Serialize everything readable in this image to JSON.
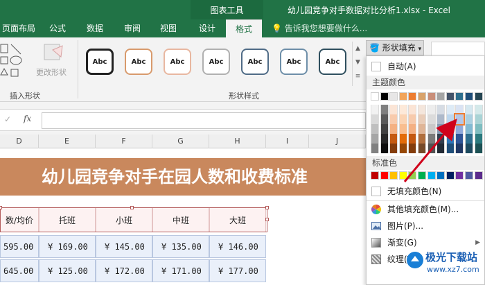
{
  "titlebar": {
    "context_group": "图表工具",
    "doc_title": "幼儿园竞争对手数据对比分析1.xlsx - Excel"
  },
  "tabs": [
    {
      "label": "页面布局"
    },
    {
      "label": "公式"
    },
    {
      "label": "数据"
    },
    {
      "label": "审阅"
    },
    {
      "label": "视图"
    },
    {
      "label": "设计"
    },
    {
      "label": "格式",
      "active": true
    }
  ],
  "tell_me": "告诉我您想要做什么...",
  "ribbon": {
    "insert_shapes_label": "插入形状",
    "edit_shape_label": "更改形状",
    "shape_styles_label": "形状样式",
    "style_preview_text": "Abc"
  },
  "formula_bar": {
    "fx": "fx",
    "cancel": "✓"
  },
  "columns": [
    "D",
    "E",
    "F",
    "G",
    "H",
    "I",
    "J"
  ],
  "sheet": {
    "banner": "幼儿园竞争对手在园人数和收费标准",
    "headers": [
      "数/均价",
      "托班",
      "小班",
      "中班",
      "大班"
    ],
    "rows": [
      [
        "595.00",
        "¥ 169.00",
        "¥ 145.00",
        "¥ 135.00",
        "¥ 146.00"
      ],
      [
        "645.00",
        "¥ 125.00",
        "¥ 172.00",
        "¥ 171.00",
        "¥ 177.00"
      ]
    ]
  },
  "shape_fill": {
    "button_label": "形状填充",
    "auto": "自动(A)",
    "theme_colors_label": "主题颜色",
    "standard_colors_label": "标准色",
    "no_fill": "无填充颜色(N)",
    "more_colors": "其他填充颜色(M)...",
    "picture": "图片(P)...",
    "gradient": "渐变(G)",
    "texture": "纹理(T)"
  },
  "theme_top_row": [
    "#ffffff",
    "#000000",
    "#e7e6e6",
    "#f2a45a",
    "#ed7d31",
    "#d9a36b",
    "#c98f7a",
    "#a5a5a5",
    "#44546a",
    "#2e6f8e",
    "#1f4e79",
    "#264653"
  ],
  "theme_shades": [
    [
      "#f2f2f2",
      "#d9d9d9",
      "#bfbfbf",
      "#a6a6a6",
      "#808080"
    ],
    [
      "#7f7f7f",
      "#595959",
      "#404040",
      "#262626",
      "#0d0d0d"
    ],
    [
      "#fbe5d6",
      "#f8cbad",
      "#f4b183",
      "#c55a11",
      "#843c0c"
    ],
    [
      "#fde9d9",
      "#fbd4b4",
      "#f9be8f",
      "#e36c09",
      "#974806"
    ],
    [
      "#fbe4d5",
      "#f7caac",
      "#f4b083",
      "#c45911",
      "#833c0b"
    ],
    [
      "#f4e6dc",
      "#e9cdb9",
      "#dfb597",
      "#b06f3e",
      "#754a29"
    ],
    [
      "#ededed",
      "#dbdbdb",
      "#c9c9c9",
      "#7b7b7b",
      "#525252"
    ],
    [
      "#d6dce4",
      "#adb9ca",
      "#8497b0",
      "#333f4f",
      "#222a35"
    ],
    [
      "#deebf6",
      "#bdd7ee",
      "#9dc3e6",
      "#2e75b6",
      "#1f4e79"
    ],
    [
      "#dae3f3",
      "#b4c7e7",
      "#8faadc",
      "#2f5597",
      "#203864"
    ],
    [
      "#d5e8f0",
      "#acd1e1",
      "#82bad2",
      "#2c6e8e",
      "#1d4a5f"
    ],
    [
      "#d4e9ea",
      "#a9d3d5",
      "#7ebdc0",
      "#2b7a7e",
      "#1c5154"
    ]
  ],
  "standard_colors": [
    "#c00000",
    "#ff0000",
    "#ffc000",
    "#ffff00",
    "#92d050",
    "#00b050",
    "#00b0f0",
    "#0070c0",
    "#002060",
    "#7030a0",
    "#4e5aa0",
    "#5b2c8c"
  ],
  "highlight_color": "#ed7d31",
  "arrow_color": "#d0021b",
  "watermark": {
    "line1": "极光下载站",
    "line2": "www.xz7.com"
  }
}
